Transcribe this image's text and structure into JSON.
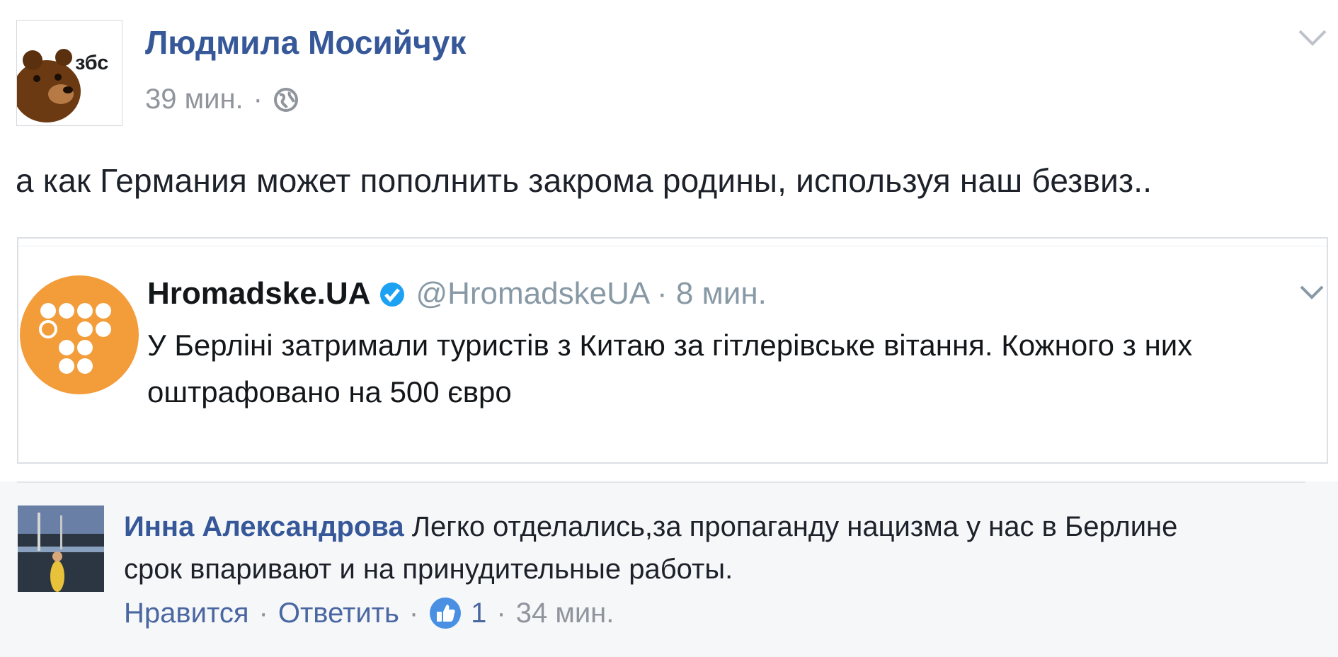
{
  "post": {
    "author": "Людмила Мосийчук",
    "time": "39 мин.",
    "separator": "·",
    "avatar_text": "збс",
    "text": "а как Германия может пополнить закрома родины, используя наш безвиз..",
    "icons": {
      "privacy": "globe-icon",
      "menu": "chevron-down-icon"
    }
  },
  "tweet": {
    "name": "Hromadske.UA",
    "handle": "@HromadskeUA · 8 мин.",
    "text": "У Берліні затримали туристів з Китаю за гітлерівське вітання. Кожного з них оштрафовано на 500 євро",
    "icons": {
      "verified": "verified-badge-icon",
      "menu": "chevron-down-icon"
    },
    "colors": {
      "avatar_bg": "#f39c3a",
      "verified": "#1da1f2"
    }
  },
  "comment": {
    "author": "Инна Александрова",
    "text": "Легко отделались,за пропаганду нацизма у нас в Берлине срок впаривают и на принудительные работы.",
    "like_label": "Нравится",
    "reply_label": "Ответить",
    "separator": "·",
    "reactions_count": "1",
    "time": "34 мин.",
    "icons": {
      "reaction": "like-icon"
    }
  },
  "colors": {
    "link": "#365899",
    "muted": "#90949c",
    "comments_bg": "#f6f7f9"
  }
}
